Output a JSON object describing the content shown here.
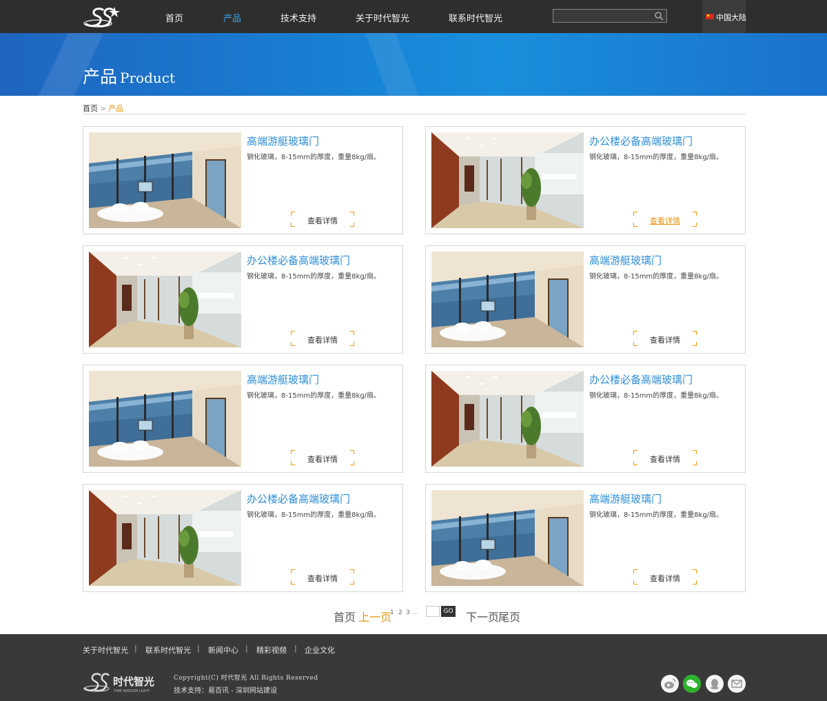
{
  "nav": {
    "items": [
      {
        "label": "首页"
      },
      {
        "label": "产品"
      },
      {
        "label": "技术支持"
      },
      {
        "label": "关于时代智光"
      },
      {
        "label": "联系时代智光"
      }
    ],
    "active_index": 1,
    "search_value": "",
    "region_label": "中国大陆"
  },
  "banner": {
    "title_cn": "产品",
    "title_en": "Product"
  },
  "breadcrumb": {
    "home": "首页",
    "separator": ">",
    "current": "产品"
  },
  "products": [
    {
      "title": "高端游艇玻璃门",
      "desc": "钢化玻璃，8-15mm的厚度，重量8kg/扇。",
      "more": "查看详情",
      "image": "yacht-interior"
    },
    {
      "title": "办公楼必备高端玻璃门",
      "desc": "钢化玻璃，8-15mm的厚度，重量8kg/扇。",
      "more": "查看详情",
      "image": "office-corridor"
    },
    {
      "title": "办公楼必备高端玻璃门",
      "desc": "钢化玻璃，8-15mm的厚度，重量8kg/扇。",
      "more": "查看详情",
      "image": "office-corridor"
    },
    {
      "title": "高端游艇玻璃门",
      "desc": "钢化玻璃，8-15mm的厚度，重量8kg/扇。",
      "more": "查看详情",
      "image": "yacht-interior"
    },
    {
      "title": "高端游艇玻璃门",
      "desc": "钢化玻璃，8-15mm的厚度，重量8kg/扇。",
      "more": "查看详情",
      "image": "yacht-interior"
    },
    {
      "title": "办公楼必备高端玻璃门",
      "desc": "钢化玻璃，8-15mm的厚度，重量8kg/扇。",
      "more": "查看详情",
      "image": "office-corridor"
    },
    {
      "title": "办公楼必备高端玻璃门",
      "desc": "钢化玻璃，8-15mm的厚度，重量8kg/扇。",
      "more": "查看详情",
      "image": "office-corridor"
    },
    {
      "title": "高端游艇玻璃门",
      "desc": "钢化玻璃，8-15mm的厚度，重量8kg/扇。",
      "more": "查看详情",
      "image": "yacht-interior"
    }
  ],
  "pagination": {
    "first": "首页",
    "prev": "上一页",
    "pages": [
      "1",
      "2",
      "3",
      "..."
    ],
    "go": "GO",
    "next": "下一页",
    "last": "尾页"
  },
  "footer": {
    "links": [
      "关于时代智光",
      "联系时代智光",
      "新闻中心",
      "精彩视频",
      "企业文化"
    ],
    "separator": "|",
    "copyright": "Copyright(C) 时代智光 All Rights Reserved",
    "tech_label": "技术支持：",
    "tech_link1": "易百讯",
    "tech_dash": " - ",
    "tech_link2": "深圳网站建设",
    "logo_cn": "时代智光",
    "logo_en": "TIME WISDOM LIGHT",
    "social_icons": [
      "weibo-icon",
      "wechat-icon",
      "qq-icon",
      "mail-icon"
    ]
  },
  "colors": {
    "accent_blue": "#2d8ed8",
    "accent_orange": "#f39800",
    "topbar": "#2e2e2e",
    "footer": "#393939"
  }
}
